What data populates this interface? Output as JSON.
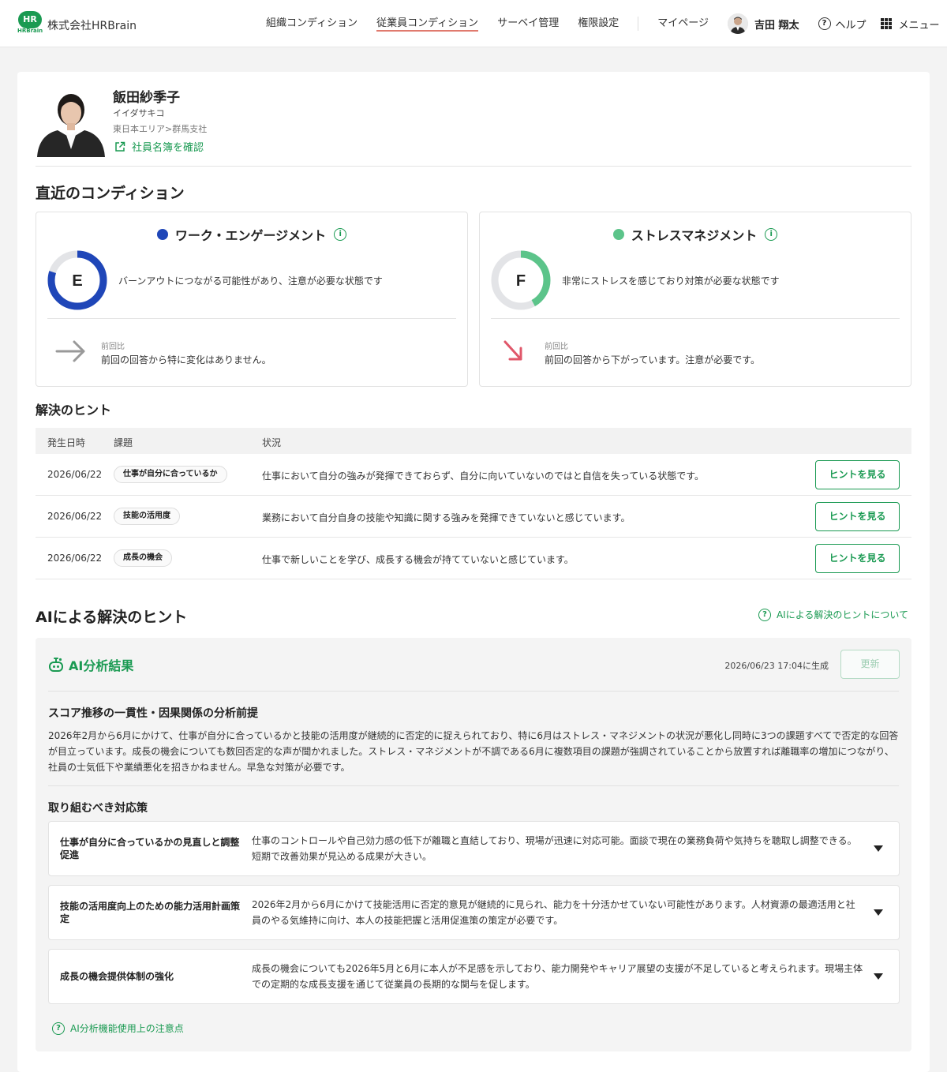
{
  "header": {
    "logo_text": "HR",
    "logo_sub": "HRBrain",
    "company": "株式会社HRBrain",
    "nav": [
      "組織コンディション",
      "従業員コンディション",
      "サーベイ管理",
      "権限設定"
    ],
    "mypage": "マイページ",
    "user_name": "吉田 翔太",
    "help": "ヘルプ",
    "menu": "メニュー"
  },
  "profile": {
    "name": "飯田紗季子",
    "kana": "イイダサキコ",
    "org": "東日本エリア>群馬支社",
    "link": "社員名簿を確認"
  },
  "conditions": {
    "title": "直近のコンディション",
    "cards": [
      {
        "title": "ワーク・エンゲージメント",
        "dot_color": "#1f46b8",
        "grade": "E",
        "ring_color": "#1f46b8",
        "ring_fill": 0.8,
        "desc": "バーンアウトにつながる可能性があり、注意が必要な状態です",
        "compare_label": "前回比",
        "compare_text": "前回の回答から特に変化はありません。",
        "trend": "flat"
      },
      {
        "title": "ストレスマネジメント",
        "dot_color": "#5cc48a",
        "grade": "F",
        "ring_color": "#5cc48a",
        "ring_fill": 0.42,
        "desc": "非常にストレスを感じており対策が必要な状態です",
        "compare_label": "前回比",
        "compare_text": "前回の回答から下がっています。注意が必要です。",
        "trend": "down"
      }
    ]
  },
  "hints": {
    "title": "解決のヒント",
    "columns": [
      "発生日時",
      "課題",
      "状況"
    ],
    "rows": [
      {
        "date": "2026/06/22",
        "tag": "仕事が自分に合っているか",
        "status": "仕事において自分の強みが発揮できておらず、自分に向いていないのではと自信を失っている状態です。",
        "button": "ヒントを見る"
      },
      {
        "date": "2026/06/22",
        "tag": "技能の活用度",
        "status": "業務において自分自身の技能や知識に関する強みを発揮できていないと感じています。",
        "button": "ヒントを見る"
      },
      {
        "date": "2026/06/22",
        "tag": "成長の機会",
        "status": "仕事で新しいことを学び、成長する機会が持てていないと感じています。",
        "button": "ヒントを見る"
      }
    ]
  },
  "ai": {
    "title": "AIによる解決のヒント",
    "about_link": "AIによる解決のヒントについて",
    "result_title": "AI分析結果",
    "generated": "2026/06/23 17:04に生成",
    "update_button": "更新",
    "analysis_title": "スコア推移の一貫性・因果関係の分析前提",
    "analysis_text": "2026年2月から6月にかけて、仕事が自分に合っているかと技能の活用度が継続的に否定的に捉えられており、特に6月はストレス・マネジメントの状況が悪化し同時に3つの課題すべてで否定的な回答が目立っています。成長の機会についても数回否定的な声が聞かれました。ストレス・マネジメントが不調である6月に複数項目の課題が強調されていることから放置すれば離職率の増加につながり、社員の士気低下や業績悪化を招きかねません。早急な対策が必要です。",
    "measures_title": "取り組むべき対応策",
    "measures": [
      {
        "title": "仕事が自分に合っているかの見直しと調整促進",
        "desc": "仕事のコントロールや自己効力感の低下が離職と直結しており、現場が迅速に対応可能。面談で現在の業務負荷や気持ちを聴取し調整できる。短期で改善効果が見込める成果が大きい。"
      },
      {
        "title": "技能の活用度向上のための能力活用計画策定",
        "desc": "2026年2月から6月にかけて技能活用に否定的意見が継続的に見られ、能力を十分活かせていない可能性があります。人材資源の最適活用と社員のやる気維持に向け、本人の技能把握と活用促進策の策定が必要です。"
      },
      {
        "title": "成長の機会提供体制の強化",
        "desc": "成長の機会についても2026年5月と6月に本人が不足感を示しており、能力開発やキャリア展望の支援が不足していると考えられます。現場主体での定期的な成長支援を通じて従業員の長期的な関与を促します。"
      }
    ],
    "note_link": "AI分析機能使用上の注意点"
  }
}
